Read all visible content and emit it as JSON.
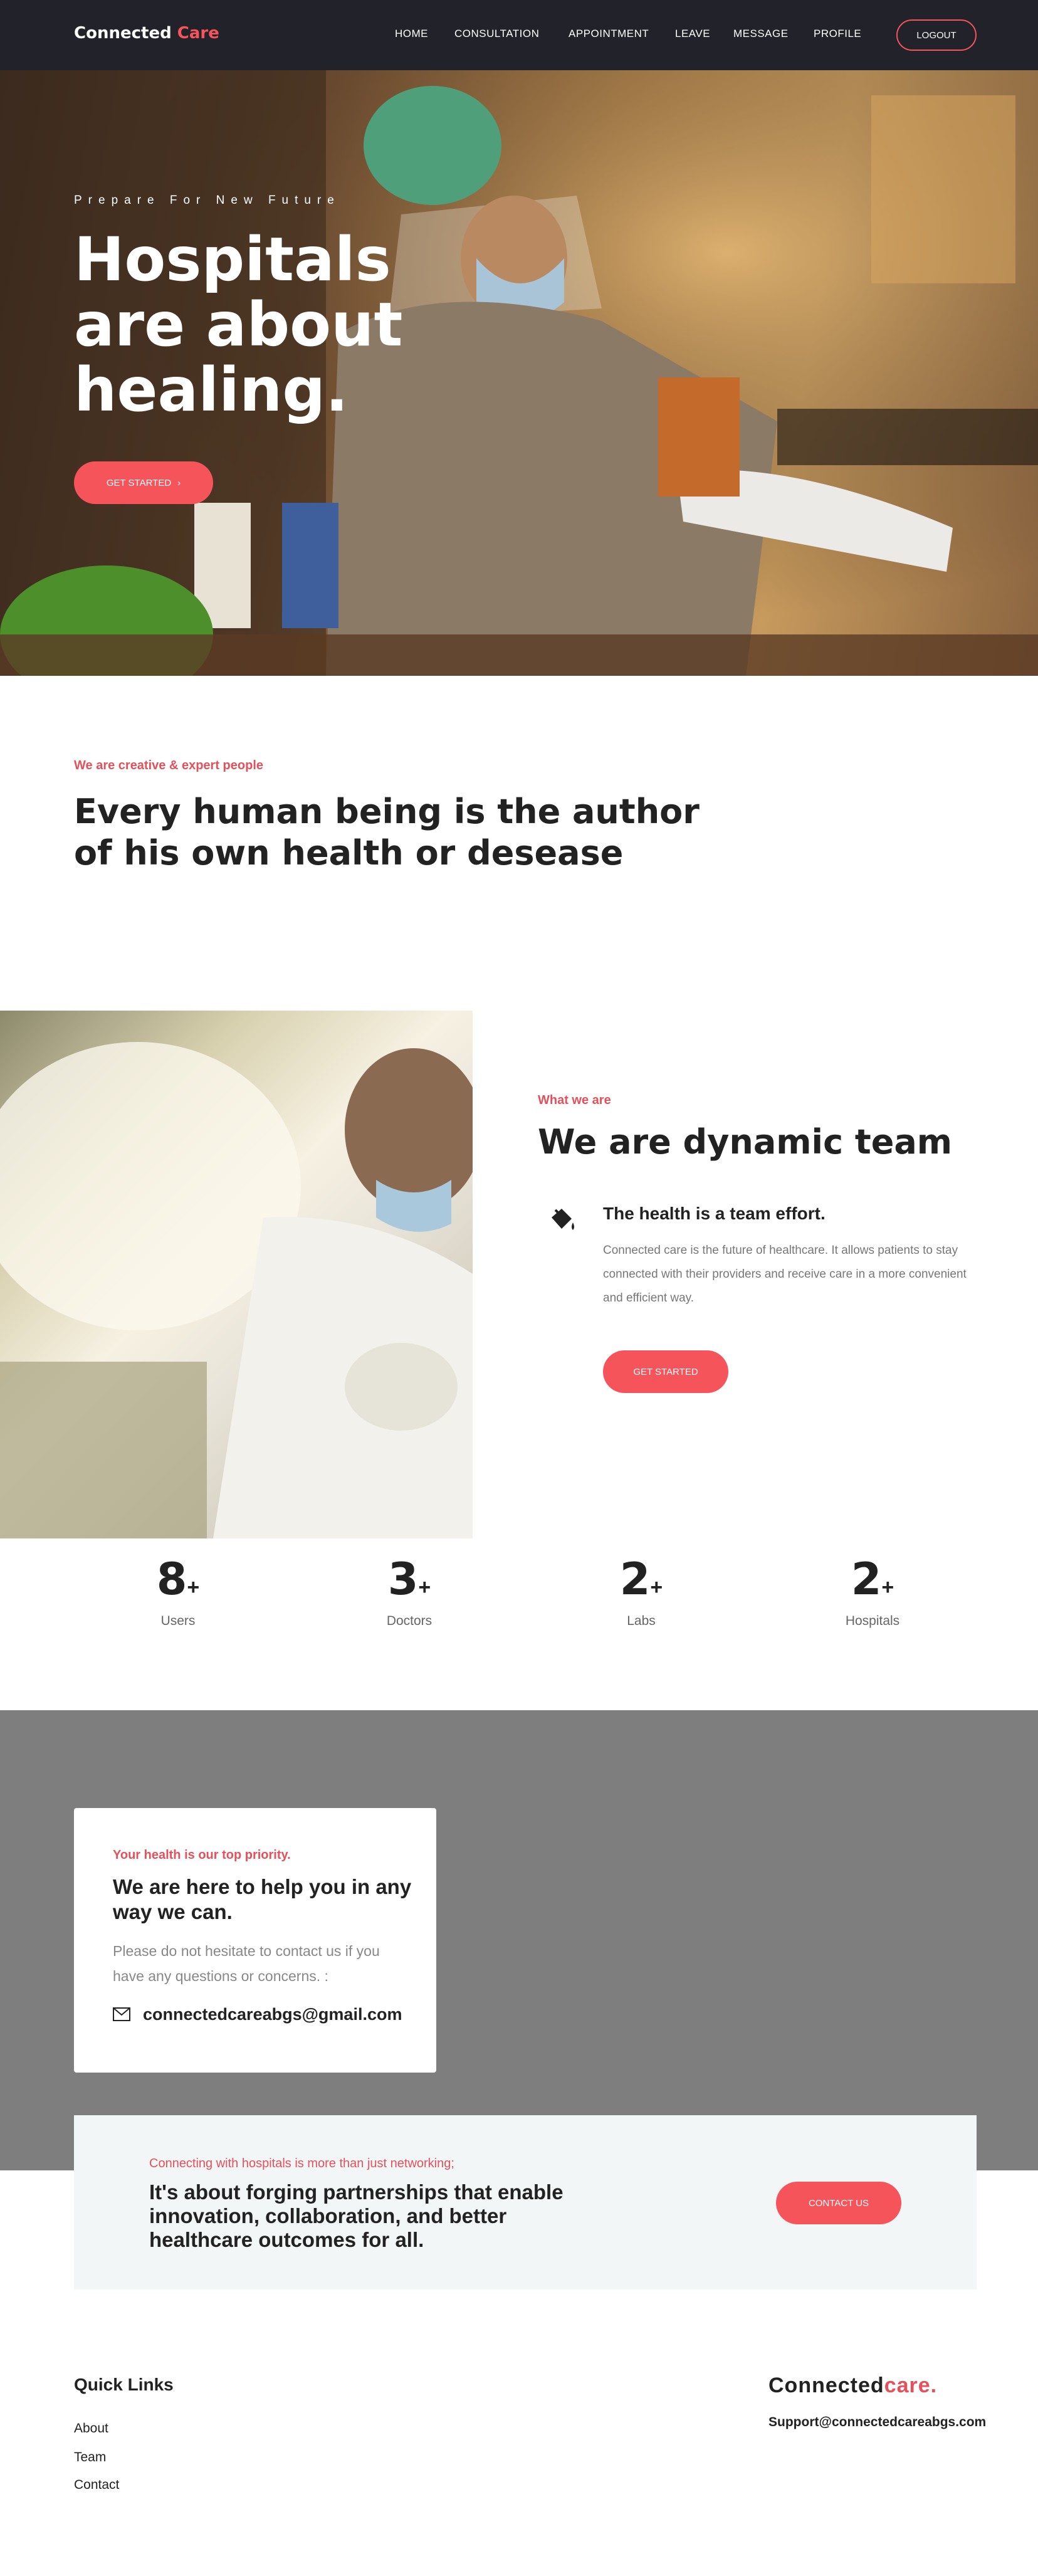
{
  "nav": {
    "brand_main": "Connected",
    "brand_accent": "Care",
    "links": [
      "HOME",
      "CONSULTATION",
      "APPOINTMENT",
      "LEAVE",
      "MESSAGE",
      "PROFILE"
    ],
    "logout_label": "LOGOUT"
  },
  "hero": {
    "eyebrow": "Prepare For New Future",
    "title": "Hospitals are about healing.",
    "cta_label": "GET STARTED"
  },
  "intro": {
    "eyebrow": "We are creative & expert people",
    "title": "Every human being is the author of his own health or desease"
  },
  "team": {
    "eyebrow": "What we are",
    "title": "We are dynamic team",
    "feature_heading": "The health is a team effort.",
    "feature_desc": "Connected care is the future of healthcare. It allows patients to stay connected with their providers and receive care in a more convenient and efficient way.",
    "cta_label": "GET STARTED"
  },
  "stats": [
    {
      "value": "8",
      "suffix": "+",
      "label": "Users"
    },
    {
      "value": "3",
      "suffix": "+",
      "label": "Doctors"
    },
    {
      "value": "2",
      "suffix": "+",
      "label": "Labs"
    },
    {
      "value": "2",
      "suffix": "+",
      "label": "Hospitals"
    }
  ],
  "contact": {
    "eyebrow": "Your health is our top priority.",
    "title": "We are here to help you in any way we can.",
    "desc": "Please do not hesitate to contact us if you have any questions or concerns. :",
    "email": "connectedcareabgs@gmail.com"
  },
  "partner": {
    "eyebrow": "Connecting with hospitals is more than just networking;",
    "title": "It's about forging partnerships that enable innovation, collaboration, and better healthcare outcomes for all.",
    "cta_label": "CONTACT US"
  },
  "footer": {
    "quick_links_heading": "Quick Links",
    "links": [
      "About",
      "Team",
      "Contact"
    ],
    "brand_main": "Connected",
    "brand_accent": "care.",
    "support_email": "Support@connectedcareabgs.com"
  },
  "colors": {
    "accent": "#f5545a",
    "nav_bg": "#21222a",
    "contact_band": "#7e7e7e",
    "panel_bg": "#f3f6f7"
  }
}
